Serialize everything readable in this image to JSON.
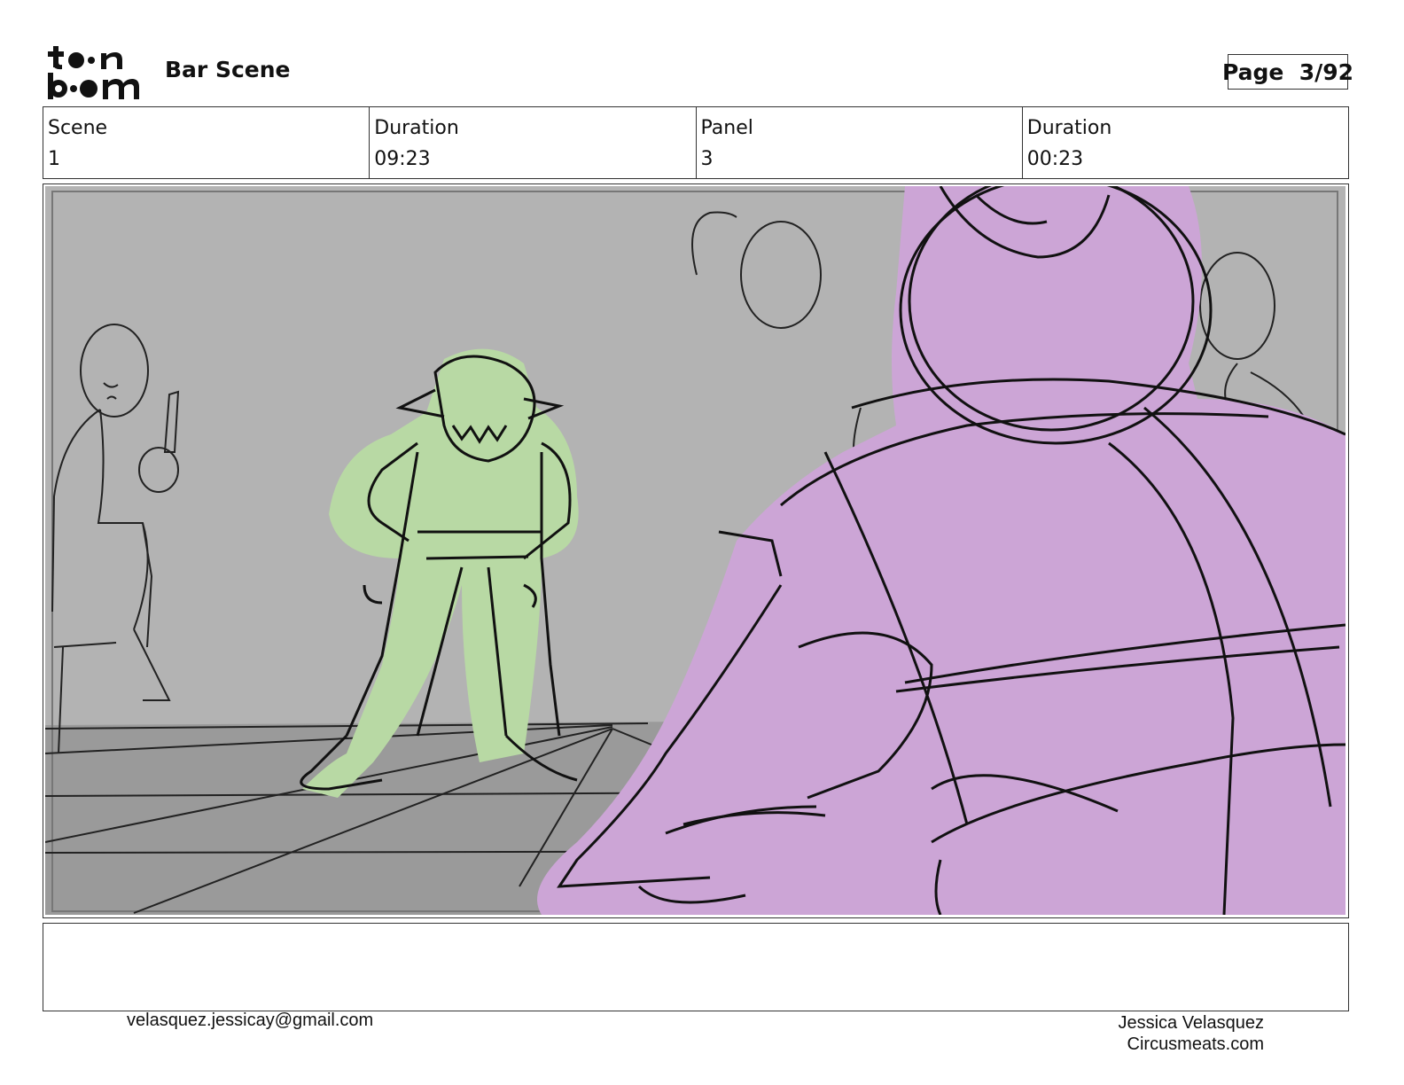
{
  "header": {
    "logo_text": "toon boom",
    "scene_title": "Bar Scene",
    "page_label": "Page  3/92"
  },
  "info": {
    "scene_label": "Scene",
    "scene_value": "1",
    "duration_label": "Duration",
    "duration_value": "09:23",
    "panel_label": "Panel",
    "panel_value": "3",
    "panel_duration_label": "Duration",
    "panel_duration_value": "00:23"
  },
  "panel": {
    "description": "",
    "colors": {
      "wall": "#b3b3b3",
      "floor": "#9a9a9a",
      "character_green": "#b8d9a4",
      "character_purple": "#cca5d6",
      "ink": "#111111"
    }
  },
  "notes": {
    "text": ""
  },
  "footer": {
    "email": "velasquez.jessicay@gmail.com",
    "author_name": "Jessica Velasquez",
    "author_site": "Circusmeats.com"
  }
}
